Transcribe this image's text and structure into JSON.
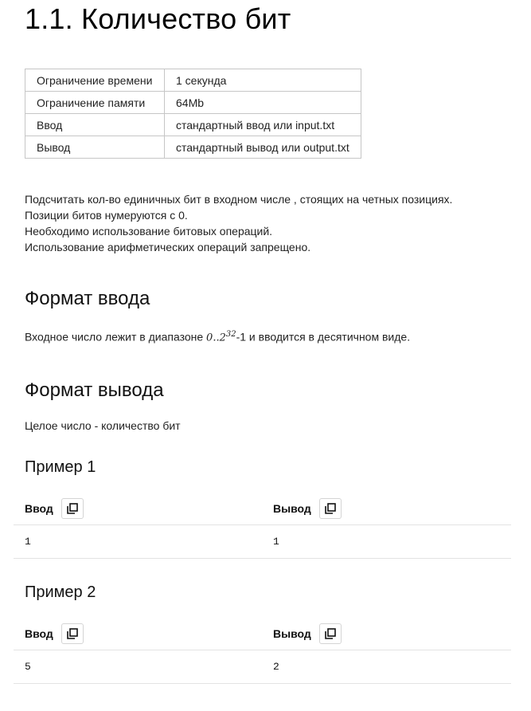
{
  "title": "1.1. Количество бит",
  "limits": [
    {
      "key": "Ограничение времени",
      "value": "1 секунда"
    },
    {
      "key": "Ограничение памяти",
      "value": "64Mb"
    },
    {
      "key": "Ввод",
      "value": "стандартный ввод или input.txt"
    },
    {
      "key": "Вывод",
      "value": "стандартный вывод или output.txt"
    }
  ],
  "statement": [
    "Подсчитать кол-во единичных бит в входном числе , стоящих на четных позициях.",
    "Позиции битов нумеруются с 0.",
    "Необходимо использование битовых операций.",
    "Использование арифметических операций запрещено."
  ],
  "input_format": {
    "heading": "Формат ввода",
    "text_before": "Входное число лежит в диапазоне ",
    "math_range": "0..2",
    "math_exp": "32",
    "text_after": "-1 и вводится в десятичном виде."
  },
  "output_format": {
    "heading": "Формат вывода",
    "text": "Целое число - количество бит"
  },
  "examples": [
    {
      "title": "Пример 1",
      "input_label": "Ввод",
      "output_label": "Вывод",
      "input": "1",
      "output": "1"
    },
    {
      "title": "Пример 2",
      "input_label": "Ввод",
      "output_label": "Вывод",
      "input": "5",
      "output": "2"
    }
  ],
  "icons": {
    "copy": "copy-icon"
  }
}
